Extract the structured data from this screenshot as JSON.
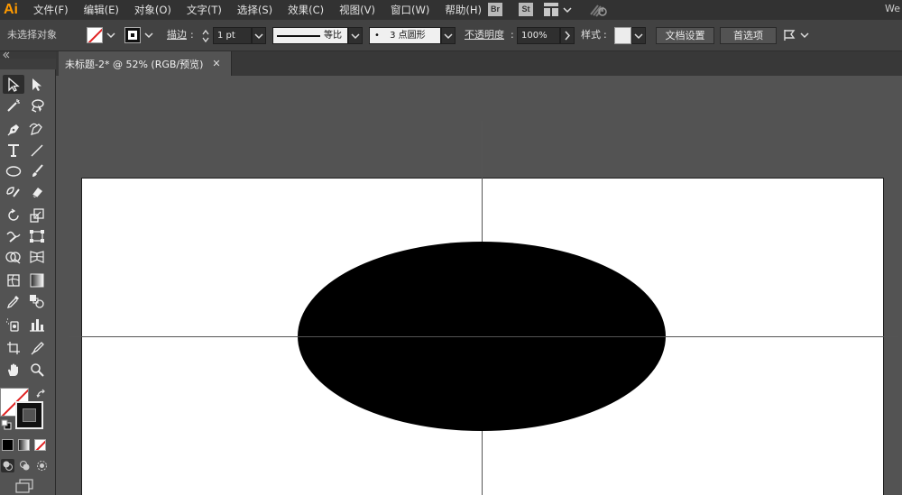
{
  "app": {
    "logo": "Ai"
  },
  "menu": [
    "文件(F)",
    "编辑(E)",
    "对象(O)",
    "文字(T)",
    "选择(S)",
    "效果(C)",
    "视图(V)",
    "窗口(W)",
    "帮助(H)"
  ],
  "menubar_right": {
    "bridge": "Br",
    "stock": "St",
    "workspace": "We"
  },
  "control": {
    "selection_status": "未选择对象",
    "stroke_label": "描边",
    "stroke_weight": "1 pt",
    "stroke_profile": "等比",
    "brush": "3 点圆形",
    "brush_dot": "•",
    "opacity_label": "不透明度",
    "opacity_value": "100%",
    "style_label": "样式",
    "doc_setup": "文档设置",
    "preferences": "首选项"
  },
  "document": {
    "tab_title": "未标题-2* @ 52% (RGB/预览)",
    "close": "✕",
    "zoom": "52%",
    "color_mode": "RGB"
  },
  "colors": {
    "menubar": "#323232",
    "control": "#424242",
    "panel": "#535353",
    "artboard": "#ffffff",
    "ellipse_fill": "#000000",
    "accent": "#ff9a00"
  },
  "tools": [
    "selection-tool",
    "direct-selection-tool",
    "magic-wand-tool",
    "lasso-tool",
    "pen-tool",
    "curvature-tool",
    "type-tool",
    "line-tool",
    "ellipse-tool",
    "paintbrush-tool",
    "shaper-tool",
    "eraser-tool",
    "rotate-tool",
    "scale-tool",
    "warp-tool",
    "free-transform-tool",
    "shape-builder-tool",
    "perspective-grid-tool",
    "mesh-tool",
    "gradient-tool",
    "eyedropper-tool",
    "blend-tool",
    "symbol-sprayer-tool",
    "column-graph-tool",
    "artboard-tool",
    "slice-tool",
    "hand-tool",
    "zoom-tool"
  ]
}
